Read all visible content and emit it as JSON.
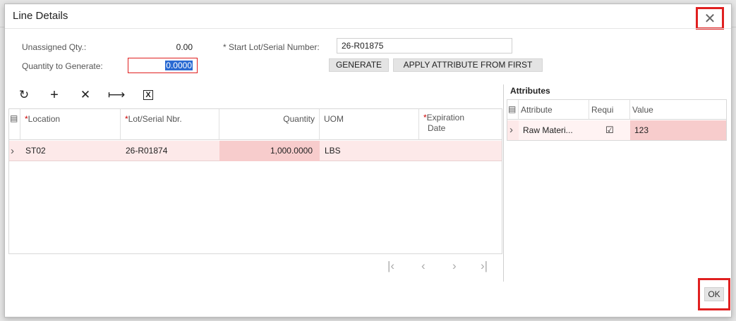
{
  "dialog": {
    "title": "Line Details"
  },
  "form": {
    "unassigned_qty_label": "Unassigned Qty.:",
    "unassigned_qty_value": "0.00",
    "qty_to_generate_label": "Quantity to Generate:",
    "qty_to_generate_value": "0.0000",
    "start_lot_label": "Start Lot/Serial Number:",
    "start_lot_value": "26-R01875",
    "required_marker": "*"
  },
  "actions": {
    "generate": "GENERATE",
    "apply_attribute": "APPLY ATTRIBUTE FROM FIRST"
  },
  "toolbar": {
    "icons": [
      "refresh-icon",
      "add-icon",
      "delete-icon",
      "fit-columns-icon",
      "export-excel-icon"
    ],
    "glyphs": [
      "↻",
      "+",
      "✕",
      "⟼",
      "X"
    ]
  },
  "left_grid": {
    "columns": [
      "Location",
      "Lot/Serial Nbr.",
      "Quantity",
      "UOM",
      "Expiration",
      "Date"
    ],
    "row": {
      "location": "ST02",
      "lot": "26-R01874",
      "quantity": "1,000.0000",
      "uom": "LBS",
      "expiration": ""
    }
  },
  "pager": {
    "first": "|‹",
    "prev": "‹",
    "next": "›",
    "last": "›|"
  },
  "attributes": {
    "title": "Attributes",
    "columns": [
      "Attribute",
      "Requi",
      "Value"
    ],
    "row": {
      "attribute": "Raw Materi...",
      "required": "☑",
      "value": "123"
    }
  },
  "footer": {
    "ok": "OK"
  },
  "colors": {
    "highlight_border": "#e02020",
    "row_bg": "#fde9e9",
    "selected_text_bg": "#2a6ad2"
  }
}
